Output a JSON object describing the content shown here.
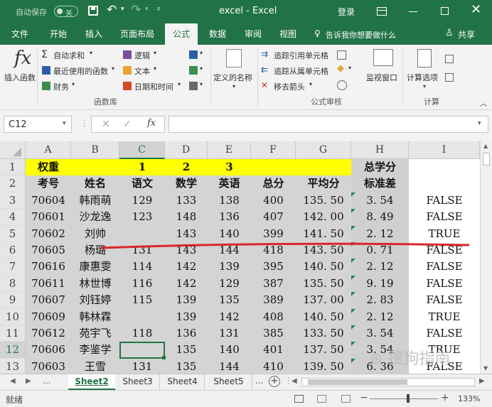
{
  "titlebar": {
    "autosave_label": "自动保存",
    "autosave_state": "关",
    "doc_title": "excel  -  Excel",
    "login_label": "登录"
  },
  "tabs": [
    {
      "label": "文件"
    },
    {
      "label": "开始"
    },
    {
      "label": "插入"
    },
    {
      "label": "页面布局"
    },
    {
      "label": "公式",
      "active": true
    },
    {
      "label": "数据"
    },
    {
      "label": "审阅"
    },
    {
      "label": "视图"
    }
  ],
  "tell_me": "告诉我你想要做什么",
  "share_label": "共享",
  "ribbon": {
    "insert_function": "插入函数",
    "autosum": "自动求和",
    "recent": "最近使用的函数",
    "financial": "财务",
    "logical": "逻辑",
    "text": "文本",
    "datetime": "日期和时间",
    "defined_names": "定义的名称",
    "trace_precedents": "追踪引用单元格",
    "trace_dependents": "追踪从属单元格",
    "remove_arrows": "移去箭头",
    "watch_window": "监视窗口",
    "calc_options": "计算选项",
    "group_library": "函数库",
    "group_audit": "公式审核",
    "group_calc": "计算"
  },
  "formula_bar": {
    "name_box": "C12",
    "fx": "fx",
    "formula": ""
  },
  "columns": [
    "A",
    "B",
    "C",
    "D",
    "E",
    "F",
    "G",
    "H",
    "I"
  ],
  "rows": [
    "1",
    "2",
    "3",
    "4",
    "5",
    "6",
    "7",
    "8",
    "9",
    "10",
    "11",
    "12",
    "13"
  ],
  "cells": [
    [
      "权重",
      "",
      "1",
      "2",
      "3",
      "",
      "",
      "总学分",
      ""
    ],
    [
      "考号",
      "姓名",
      "语文",
      "数学",
      "英语",
      "总分",
      "平均分",
      "标准差",
      ""
    ],
    [
      "70604",
      "韩雨萌",
      "129",
      "133",
      "138",
      "400",
      "135. 50",
      "3. 54",
      "FALSE"
    ],
    [
      "70601",
      "沙龙逸",
      "123",
      "148",
      "136",
      "407",
      "142. 00",
      "8. 49",
      "FALSE"
    ],
    [
      "70602",
      "刘帅",
      "",
      "143",
      "140",
      "399",
      "141. 50",
      "2. 12",
      "TRUE"
    ],
    [
      "70605",
      "杨璐",
      "131",
      "143",
      "144",
      "418",
      "143. 50",
      "0. 71",
      "FALSE"
    ],
    [
      "70616",
      "康惠雯",
      "114",
      "142",
      "139",
      "395",
      "140. 50",
      "2. 12",
      "FALSE"
    ],
    [
      "70611",
      "林世博",
      "116",
      "142",
      "129",
      "387",
      "135. 50",
      "9. 19",
      "FALSE"
    ],
    [
      "70607",
      "刘钰婷",
      "115",
      "139",
      "135",
      "389",
      "137. 00",
      "2. 83",
      "FALSE"
    ],
    [
      "70609",
      "韩林霖",
      "",
      "139",
      "142",
      "408",
      "140. 50",
      "2. 12",
      "TRUE"
    ],
    [
      "70612",
      "苑宇飞",
      "118",
      "136",
      "131",
      "385",
      "133. 50",
      "3. 54",
      "FALSE"
    ],
    [
      "70606",
      "李鉴学",
      "",
      "135",
      "140",
      "401",
      "137. 50",
      "3. 54",
      "TRUE"
    ],
    [
      "70603",
      "王雪",
      "131",
      "135",
      "144",
      "410",
      "139. 50",
      "6. 36",
      "FALSE"
    ]
  ],
  "sheets": [
    {
      "label": "Sheet2",
      "active": true
    },
    {
      "label": "Sheet3"
    },
    {
      "label": "Sheet4"
    },
    {
      "label": "Sheet5"
    }
  ],
  "sheet_more": "...",
  "status": {
    "ready": "就绪",
    "zoom": "133%"
  },
  "watermark": "搜狗指南 zhinan.sogou.com",
  "colors": {
    "excel_green": "#217346",
    "header_yellow": "#ffff00",
    "red_line": "#d9262b",
    "selected_header": "#d2d2d2"
  }
}
